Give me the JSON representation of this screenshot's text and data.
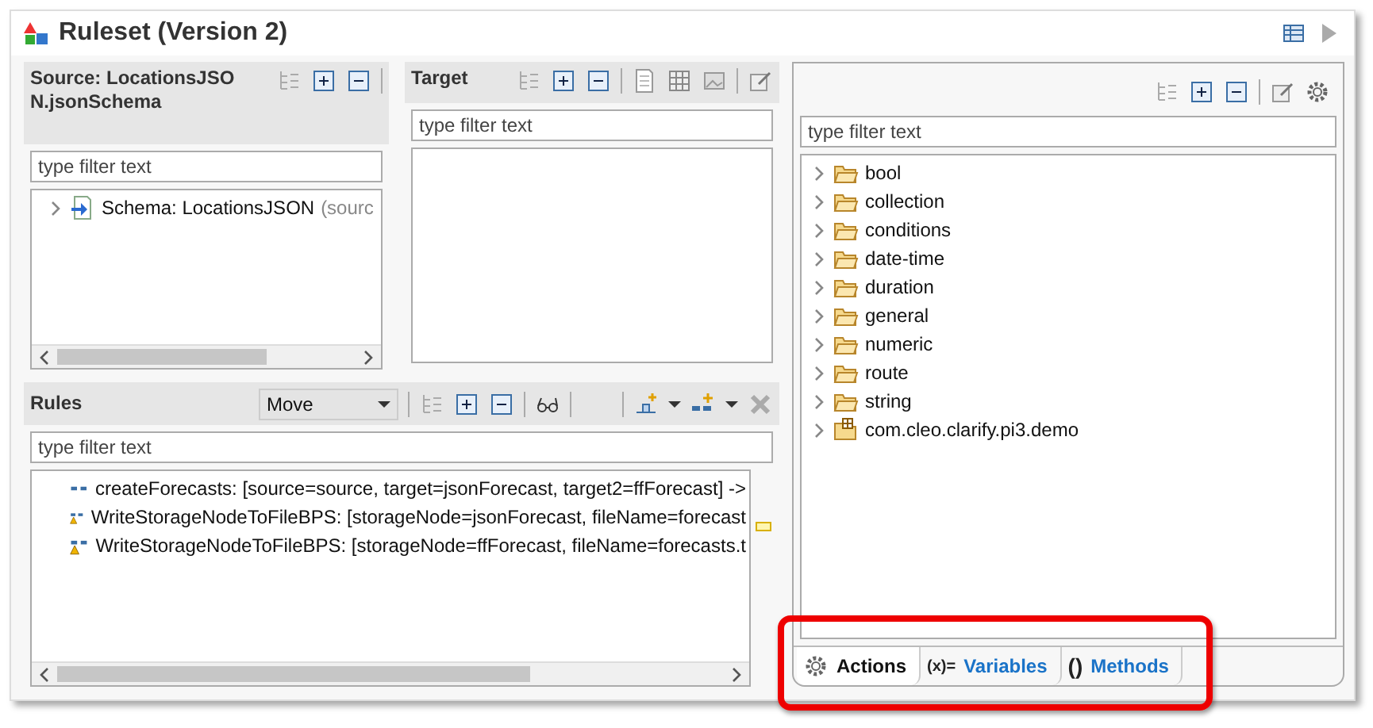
{
  "window": {
    "title": "Ruleset (Version 2)"
  },
  "source": {
    "title": "Source: LocationsJSON.jsonSchema",
    "filter": {
      "placeholder": "type filter text"
    },
    "items": [
      {
        "label": "Schema: LocationsJSON",
        "detail": "(sourc",
        "expanded": false
      }
    ]
  },
  "target": {
    "title": "Target",
    "filter": {
      "placeholder": "type filter text"
    }
  },
  "rules": {
    "title": "Rules",
    "mode": "Move",
    "filter": {
      "placeholder": "type filter text"
    },
    "rows": [
      {
        "kind": "plain",
        "text": "createForecasts: [source=source, target=jsonForecast, target2=ffForecast] ->"
      },
      {
        "kind": "warning",
        "text": "WriteStorageNodeToFileBPS: [storageNode=jsonForecast, fileName=forecast"
      },
      {
        "kind": "warning",
        "text": "WriteStorageNodeToFileBPS: [storageNode=ffForecast, fileName=forecasts.t"
      }
    ]
  },
  "palette": {
    "filter": {
      "placeholder": "type filter text"
    },
    "items": [
      {
        "kind": "folder",
        "label": "bool",
        "expanded": false
      },
      {
        "kind": "folder",
        "label": "collection",
        "expanded": false
      },
      {
        "kind": "folder",
        "label": "conditions",
        "expanded": false
      },
      {
        "kind": "folder",
        "label": "date-time",
        "expanded": false
      },
      {
        "kind": "folder",
        "label": "duration",
        "expanded": false
      },
      {
        "kind": "folder",
        "label": "general",
        "expanded": false
      },
      {
        "kind": "folder",
        "label": "numeric",
        "expanded": false
      },
      {
        "kind": "folder",
        "label": "route",
        "expanded": false
      },
      {
        "kind": "folder",
        "label": "string",
        "expanded": false
      },
      {
        "kind": "package",
        "label": "com.cleo.clarify.pi3.demo",
        "expanded": false
      }
    ],
    "tabs": [
      {
        "label": "Actions",
        "selected": true
      },
      {
        "label": "Variables",
        "symbol": "(x)=",
        "selected": false
      },
      {
        "label": "Methods",
        "symbol": "()",
        "selected": false
      }
    ]
  }
}
